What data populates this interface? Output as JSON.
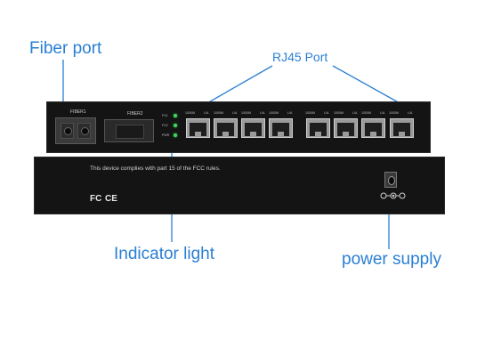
{
  "callouts": {
    "fiber_port": "Fiber port",
    "rj45_port": "RJ45 Port",
    "indicator_light": "Indicator light",
    "power_supply": "power supply"
  },
  "front_panel": {
    "fiber1_label": "FIBER1",
    "fiber2_label": "FIBER2",
    "leds": [
      "FX1",
      "FX2",
      "PWR"
    ],
    "port_labels": [
      [
        "1000M",
        "L/A"
      ],
      [
        "1000M",
        "L/A"
      ],
      [
        "1000M",
        "L/A"
      ],
      [
        "1000M",
        "L/A"
      ],
      [
        "1000M",
        "L/A"
      ],
      [
        "1000M",
        "L/A"
      ],
      [
        "1000M",
        "L/A"
      ],
      [
        "1000M",
        "L/A"
      ]
    ]
  },
  "back_panel": {
    "fcc_text": "This device complies with part 15 of the FCC rules.",
    "logo_text": "FC CE"
  },
  "colors": {
    "callout": "#2a7fd4",
    "device_body": "#141414",
    "led_green": "#3ed85a"
  }
}
